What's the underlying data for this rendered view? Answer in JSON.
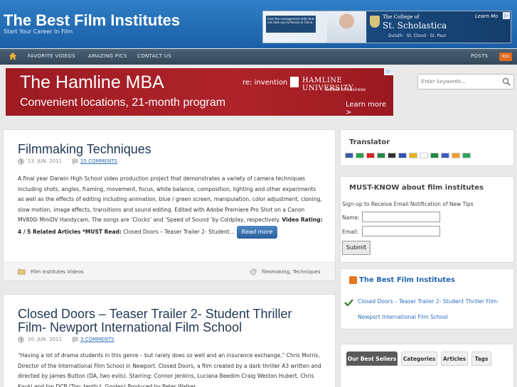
{
  "site": {
    "title": "The Best Film Institutes",
    "tagline": "Start Your Career In Film"
  },
  "top_ad": {
    "inset_text": "Gain the management skills that can take you to Russia or China.",
    "college_line": "The College of",
    "school": "St. Scholastica",
    "cities": "Duluth · St. Cloud · St. Paul",
    "learn_more": "Learn Mo"
  },
  "nav": {
    "home_icon": "home-icon",
    "items": [
      "FAVORITE VIDEOS",
      "AMAZING PICS",
      "CONTACT US"
    ],
    "posts_label": "POSTS",
    "rss_label": "RSS"
  },
  "mba_ad": {
    "title": "The Hamline MBA",
    "subtitle": "Convenient locations, 21-month program",
    "reinvention": "re: invention",
    "university": "HAMLINE UNIVERSITY",
    "school": "School of Business",
    "learn_more": "Learn more >"
  },
  "search": {
    "placeholder": "Enter keywords..."
  },
  "posts": [
    {
      "title": "Filmmaking Techniques",
      "date": "23. JUN. 2011",
      "comments": "25 COMMENTS",
      "body": "A final year Darwin High School video production project that demonstrates a variety of camera techniques including shots, angles, framing, movement, focus, white balance, composition, lighting and other experiments as well as the effects of editing including animation, blue / green screen, manipulation, color adjustment, cloning, slow motion, image effects, transitions and sound editing. Edited with Adobe Premiere Pro Shot on a Canon MV800i MiniDV Handycam. The songs are ‘Clocks’ and ‘Speed of Sound ’by Coldplay, respectively. ",
      "rating": "Video Rating: 4 / 5 Related Articles *MUST Read:",
      "body_tail": " Closed Doors – Teaser Trailer 2- Student…",
      "read_more": "Read more",
      "category": "Film Institutes Videos",
      "tags": "filmmaking, Techniques"
    },
    {
      "title": "Closed Doors – Teaser Trailer 2- Student Thriller Film- Newport International Film School",
      "date": "20. JUN. 2011",
      "comments": "3 COMMENTS",
      "body": "“Having a lot of drama students in this genre – but rarely does so well and an insurance exchange,” Chris Morris, Director of the International Film School in Newport. Closed Doors, a film created by a dark thriller A3 written and directed by James Button (DA, two evils). Starring: Connor Jenkins, Luciana Beedim Craig Weston Hubert, Chris Kauki and Jim DCB (Top: tenth t. Goolen) Produced by Peter Walker"
    }
  ],
  "sidebar": {
    "translator": {
      "title": "Translator",
      "flags": [
        {
          "name": "english",
          "color": "#3b5aa8"
        },
        {
          "name": "italian",
          "color": "#2e9e48"
        },
        {
          "name": "chinese",
          "color": "#d8231f"
        },
        {
          "name": "portuguese",
          "color": "#27864a"
        },
        {
          "name": "german",
          "color": "#333333"
        },
        {
          "name": "french",
          "color": "#3056b5"
        },
        {
          "name": "spanish",
          "color": "#e8b21a"
        },
        {
          "name": "japanese",
          "color": "#ffffff"
        },
        {
          "name": "arabic",
          "color": "#1f8a45"
        },
        {
          "name": "russian",
          "color": "#3a5cc0"
        },
        {
          "name": "hindi",
          "color": "#f39b2e"
        },
        {
          "name": "irish",
          "color": "#2ea35a"
        }
      ]
    },
    "mustknow": {
      "title": "MUST-KNOW about film institutes",
      "signup": "Sign-up to Receive Email Notification of New Tips",
      "name_label": "Name:",
      "email_label": "Email:",
      "submit": "Submit"
    },
    "rss": {
      "title": "The Best Film Institutes",
      "link": "Closed Doors – Teaser Trailer 2- Student Thriller Film- Newport International Film School"
    },
    "tabs": [
      "Our Best Sellers",
      "Categories",
      "Articles",
      "Tags"
    ]
  }
}
